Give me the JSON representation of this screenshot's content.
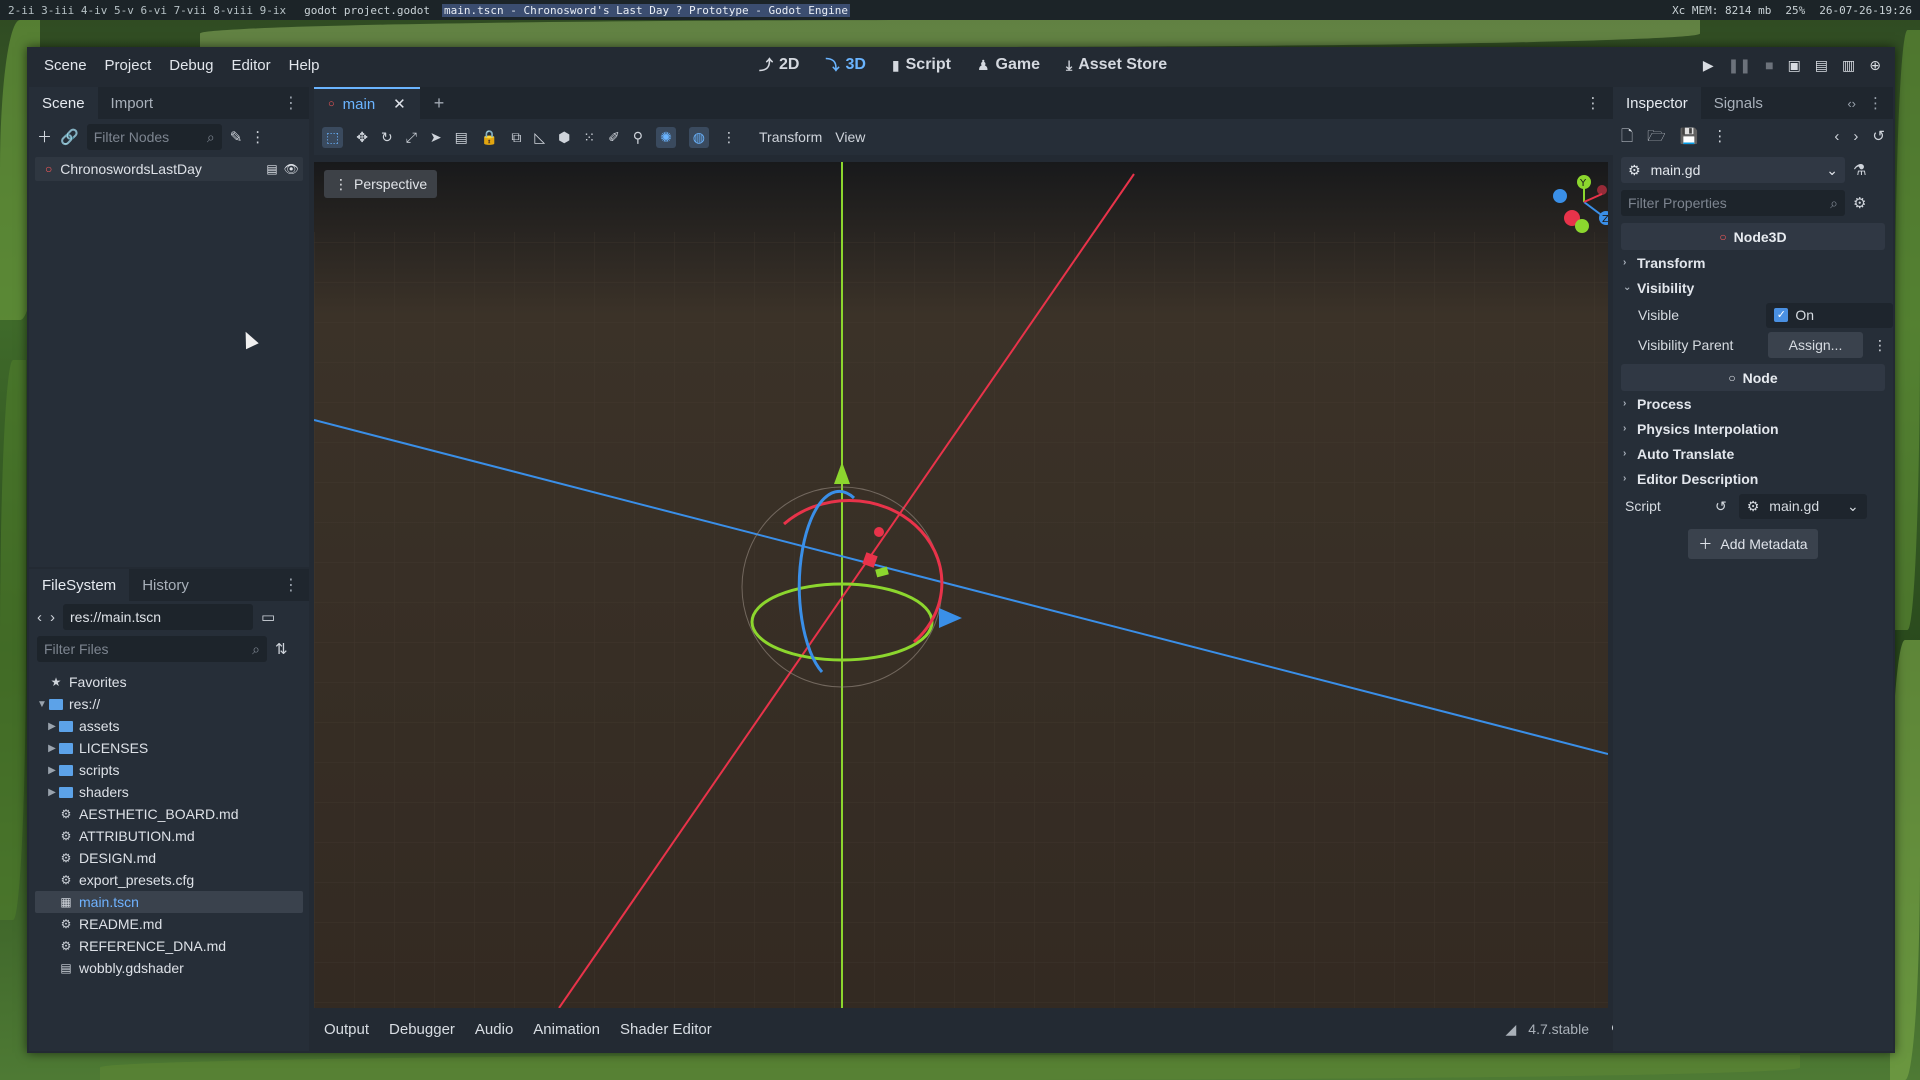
{
  "topbar": {
    "workspaces": "2-ii 3-iii 4-iv 5-v 6-vi 7-vii 8-viii 9-ix",
    "terminal_title": "godot project.godot",
    "window_title": "main.tscn - Chronosword's Last Day ? Prototype - Godot Engine",
    "mem": "Xc MEM: 8214 mb",
    "percent": "25%",
    "datetime": "26-07-26-19:26"
  },
  "menu": [
    "Scene",
    "Project",
    "Debug",
    "Editor",
    "Help"
  ],
  "workspaces": [
    "2D",
    "3D",
    "Script",
    "Game",
    "Asset Store"
  ],
  "scene_dock": {
    "tabs": [
      "Scene",
      "Import"
    ],
    "filter_placeholder": "Filter Nodes",
    "root_node": "ChronoswordsLastDay"
  },
  "filesystem": {
    "tabs": [
      "FileSystem",
      "History"
    ],
    "path": "res://main.tscn",
    "filter_placeholder": "Filter Files",
    "favorites": "Favorites",
    "root": "res://",
    "folders": [
      "assets",
      "LICENSES",
      "scripts",
      "shaders"
    ],
    "files": [
      "AESTHETIC_BOARD.md",
      "ATTRIBUTION.md",
      "DESIGN.md",
      "export_presets.cfg",
      "main.tscn",
      "README.md",
      "REFERENCE_DNA.md",
      "wobbly.gdshader"
    ],
    "selected": "main.tscn"
  },
  "editor_tab": "main",
  "viewport_toolbar": {
    "transform": "Transform",
    "view": "View"
  },
  "viewport": {
    "perspective": "Perspective"
  },
  "inspector": {
    "tabs": [
      "Inspector",
      "Signals"
    ],
    "resource": "main.gd",
    "filter_placeholder": "Filter Properties",
    "section_node3d": "Node3D",
    "transform": "Transform",
    "visibility": "Visibility",
    "visible_label": "Visible",
    "visible_value": "On",
    "visibility_parent_label": "Visibility Parent",
    "assign": "Assign...",
    "section_node": "Node",
    "process": "Process",
    "physics_interpolation": "Physics Interpolation",
    "auto_translate": "Auto Translate",
    "editor_description": "Editor Description",
    "script_label": "Script",
    "script_value": "main.gd",
    "add_metadata": "Add Metadata"
  },
  "bottom_tabs": [
    "Output",
    "Debugger",
    "Audio",
    "Animation",
    "Shader Editor"
  ],
  "version": "4.7.stable",
  "colors": {
    "accent": "#6ab4ff",
    "x_axis": "#e8334a",
    "y_axis": "#8cd62e",
    "z_axis": "#3a8fe8"
  }
}
